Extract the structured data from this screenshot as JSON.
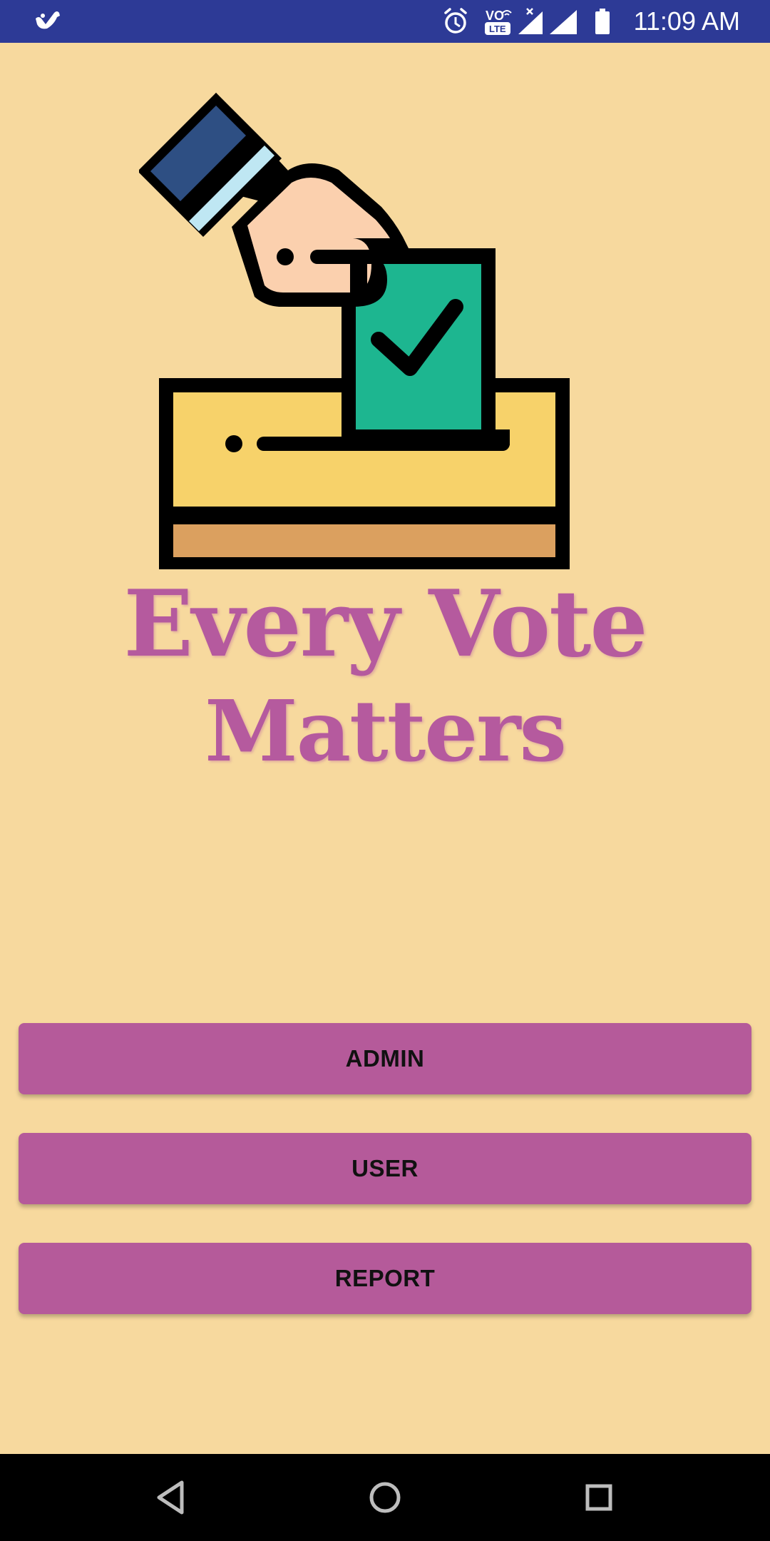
{
  "status_bar": {
    "time": "11:09 AM",
    "network_badge_top": "VO",
    "network_badge_bottom": "LTE",
    "icons": [
      "app-notification-icon",
      "alarm-icon",
      "volte-icon",
      "signal-no-data-icon",
      "signal-icon",
      "battery-icon"
    ]
  },
  "logo": {
    "line1": "Every Vote",
    "line2": "Matters",
    "text_color": "#B55A9E"
  },
  "buttons": {
    "admin": "ADMIN",
    "user": "USER",
    "report": "REPORT"
  },
  "nav_bar": {
    "icons": [
      "back-icon",
      "home-icon",
      "recents-icon"
    ]
  },
  "colors": {
    "background": "#F7D99E",
    "status_bar": "#2D3A96",
    "button": "#B55A9A",
    "nav_bar": "#000000"
  }
}
